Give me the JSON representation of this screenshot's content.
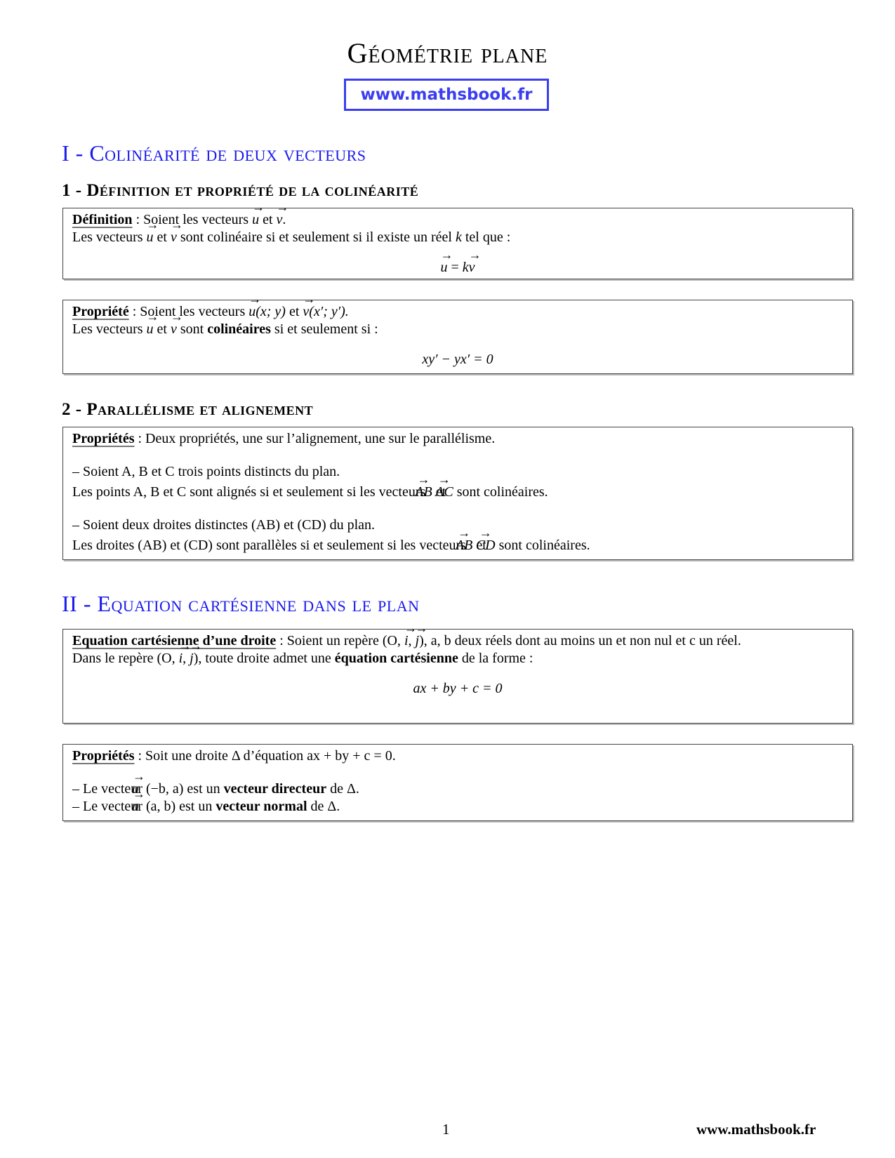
{
  "header": {
    "title": "Géométrie plane",
    "site_link": "www.mathsbook.fr",
    "accent_color": "#3a3ef0"
  },
  "section1": {
    "title": "I - Colinéarité de deux vecteurs",
    "sub1": {
      "title": "1 - Définition et propriété de la colinéarité",
      "definition": {
        "label": "Définition",
        "line1_a": " : Soient les vecteurs ",
        "u": "u",
        "et": " et ",
        "v": "v",
        "line1_end": ".",
        "line2_a": "Les vecteurs ",
        "line2_b": " sont colinéaire si et seulement si il existe un réel ",
        "k": "k",
        "line2_end": " tel que :",
        "formula_eq": " = ",
        "formula_k": "k"
      },
      "property": {
        "label": "Propriété",
        "line1_a": " : Soient les vecteurs ",
        "u_coords": "(x; y)",
        "v_coords": "(x′; y′).",
        "line2_a": "Les vecteurs ",
        "line2_b": " sont ",
        "line2_bold": "colinéaires",
        "line2_end": " si et seulement si :",
        "formula": "xy′ − yx′ = 0"
      }
    },
    "sub2": {
      "title": "2 - Parallélisme et alignement",
      "properties": {
        "label": "Propriétés",
        "intro": " : Deux propriétés, une sur l’alignement, une sur le parallélisme.",
        "item1_line1": "– Soient A, B et C trois points distincts du plan.",
        "item1_line2_a": "Les points A, B et C sont alignés si et seulement si les vecteurs ",
        "AB": "AB",
        "AC": "AC",
        "et": " et ",
        "item1_line2_end": " sont colinéaires.",
        "item2_line1": "– Soient deux droites distinctes (AB) et (CD) du plan.",
        "item2_line2_a": "Les droites (AB) et (CD) sont parallèles si et seulement si les vecteurs ",
        "CD": "CD",
        "item2_line2_end": " sont colinéaires."
      }
    }
  },
  "section2": {
    "title": "II - Equation cartésienne dans le plan",
    "equation": {
      "label": "Equation cartésienne d’une droite",
      "line1_a": " : Soient un repère (O, ",
      "i": "i",
      "comma": ", ",
      "j": "j",
      "line1_b": "), a, b deux réels dont au moins un et non nul et c un réel.",
      "line2_a": "Dans le repère (O, ",
      "line2_b": "), toute droite admet une ",
      "line2_bold": "équation cartésienne",
      "line2_end": " de la forme :",
      "formula": "ax + by + c = 0"
    },
    "properties": {
      "label": "Propriétés",
      "intro": " : Soit une droite Δ d’équation ax + by + c = 0.",
      "item1_a": "– Le vecteur ",
      "u": "u",
      "item1_coords": "(−b, a) est un ",
      "item1_bold": "vecteur directeur",
      "item1_end": " de Δ.",
      "item2_a": "– Le vecteur ",
      "n": "n",
      "item2_coords": "(a, b) est un ",
      "item2_bold": "vecteur normal",
      "item2_end": " de Δ."
    }
  },
  "footer": {
    "page_number": "1",
    "site": "www.mathsbook.fr"
  }
}
